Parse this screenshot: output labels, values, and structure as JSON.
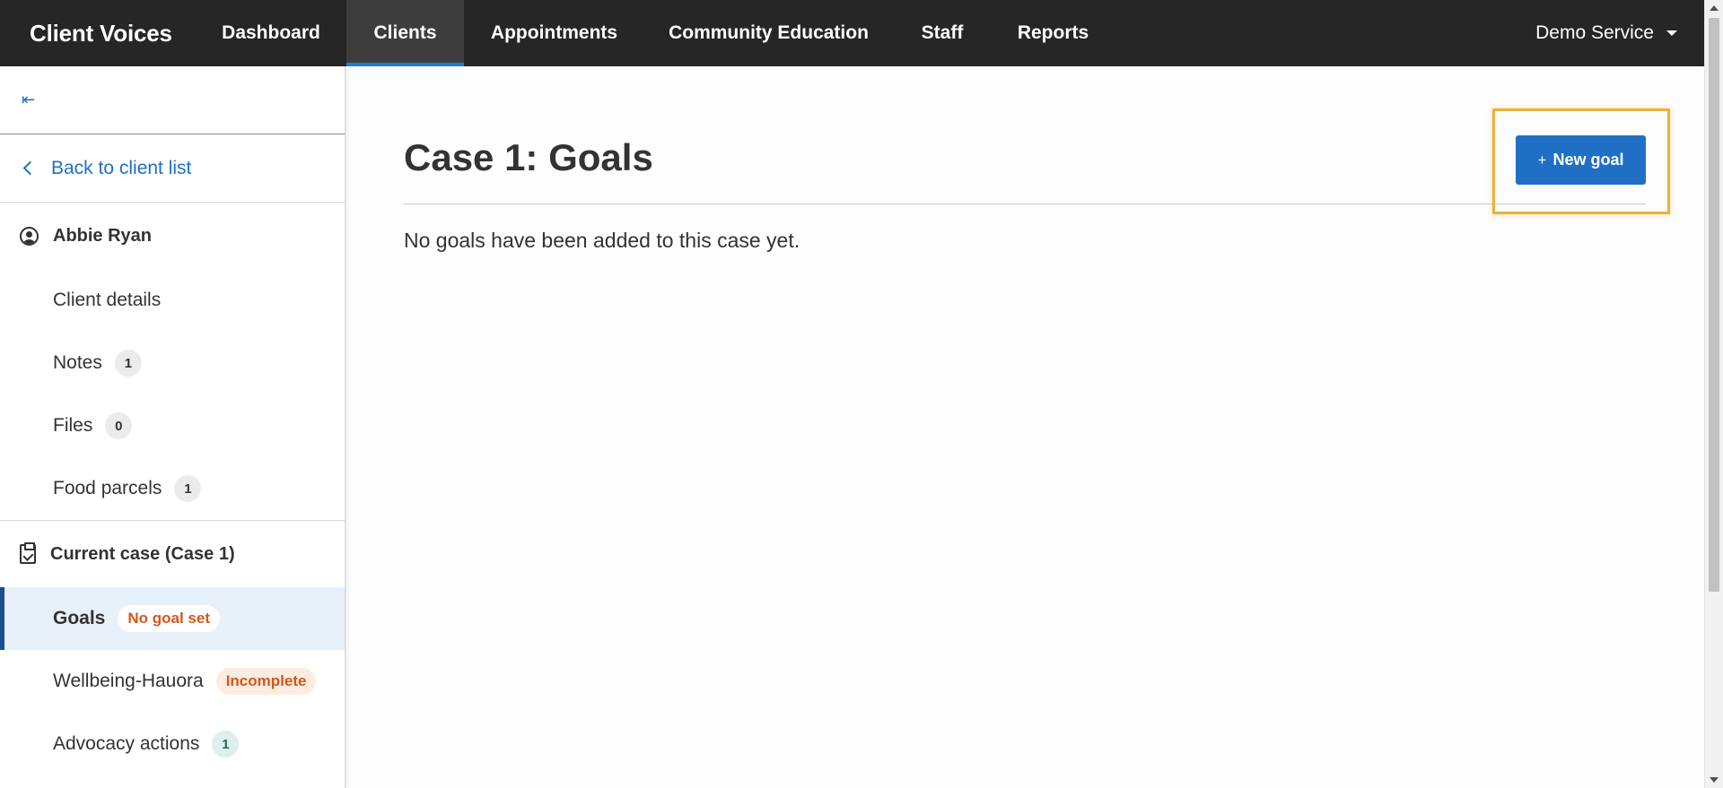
{
  "app": {
    "brand": "Client Voices"
  },
  "nav": {
    "links": [
      {
        "label": "Dashboard"
      },
      {
        "label": "Clients"
      },
      {
        "label": "Appointments"
      },
      {
        "label": "Community Education"
      },
      {
        "label": "Staff"
      },
      {
        "label": "Reports"
      }
    ],
    "active": "Clients",
    "account_label": "Demo Service"
  },
  "sidebar": {
    "collapse_icon": "⇤",
    "back_label": "Back to client list",
    "client": {
      "name": "Abbie Ryan",
      "items": [
        {
          "label": "Client details"
        },
        {
          "label": "Notes",
          "count": "1"
        },
        {
          "label": "Files",
          "count": "0"
        },
        {
          "label": "Food parcels",
          "count": "1"
        }
      ]
    },
    "case": {
      "title": "Current case (Case 1)",
      "items": [
        {
          "label": "Goals",
          "status": "No goal set",
          "active": true
        },
        {
          "label": "Wellbeing-Hauora",
          "status": "Incomplete"
        },
        {
          "label": "Advocacy actions",
          "count": "1"
        }
      ]
    }
  },
  "main": {
    "title": "Case 1: Goals",
    "new_goal_label": "New goal",
    "empty_message": "No goals have been added to this case yet."
  },
  "colors": {
    "nav_bg": "#262626",
    "accent": "#1f6fc5",
    "active_bar": "#1b4f8f",
    "highlight": "#e8b33b",
    "status_orange": "#d2581c"
  }
}
